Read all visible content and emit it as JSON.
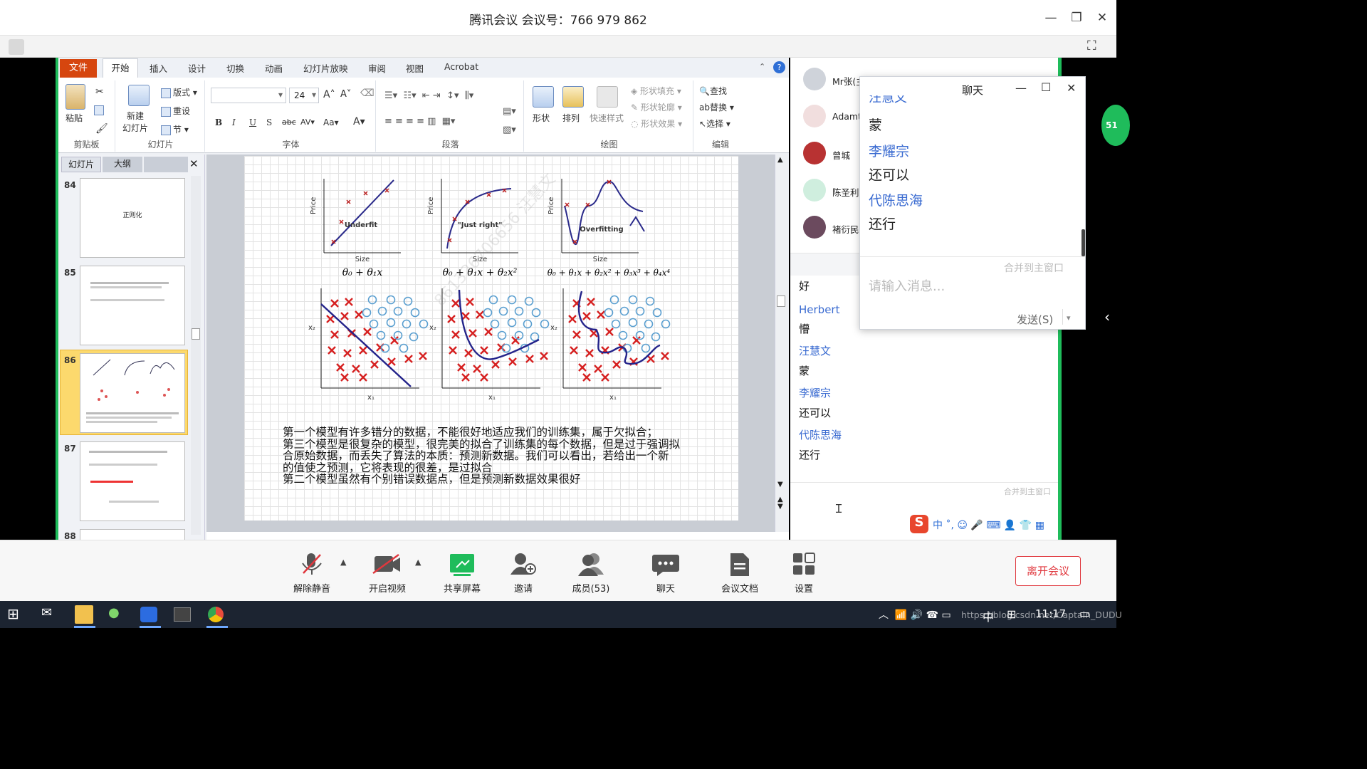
{
  "window": {
    "title": "腾讯会议 会议号：766 979 862"
  },
  "ribbon": {
    "tabs": [
      "文件",
      "开始",
      "插入",
      "设计",
      "切换",
      "动画",
      "幻灯片放映",
      "审阅",
      "视图",
      "Acrobat"
    ],
    "clipboard": {
      "paste": "粘贴",
      "name": "剪贴板"
    },
    "slides": {
      "new_slide": "新建\n幻灯片",
      "layout": "版式",
      "reset": "重设",
      "section": "节",
      "name": "幻灯片"
    },
    "font": {
      "size": "24",
      "name": "字体"
    },
    "paragraph": {
      "name": "段落"
    },
    "drawing": {
      "shape": "形状",
      "arrange": "排列",
      "quick_styles": "快速样式",
      "fill": "形状填充",
      "outline": "形状轮廓",
      "effect": "形状效果",
      "name": "绘图"
    },
    "editing": {
      "find": "查找",
      "replace": "替换",
      "select": "选择",
      "name": "编辑"
    }
  },
  "thumbs": {
    "tab_slides": "幻灯片",
    "tab_outline": "大纲",
    "items": [
      {
        "num": "84",
        "text": "正则化"
      },
      {
        "num": "85"
      },
      {
        "num": "86"
      },
      {
        "num": "87"
      },
      {
        "num": "88"
      }
    ]
  },
  "slide": {
    "plots": [
      {
        "ylabel": "Price",
        "xlabel": "Size",
        "label": "Underfit",
        "formula": "θ₀ + θ₁x"
      },
      {
        "ylabel": "Price",
        "xlabel": "Size",
        "label": "\"Just right\"",
        "formula": "θ₀ + θ₁x + θ₂x²"
      },
      {
        "ylabel": "Price",
        "xlabel": "Size",
        "label": "Overfitting",
        "formula": "θ₀ + θ₁x + θ₂x² + θ₃x³ + θ₄x⁴"
      }
    ],
    "class_plots": {
      "xlabel": "x₁",
      "ylabel": "x₂"
    },
    "text": [
      "第一个模型有许多错分的数据，不能很好地适应我们的训练集，属于欠拟合；",
      "第三个模型是很复杂的模型，很完美的拟合了训练集的每个数据，但是过于强调拟",
      "合原始数据，而丢失了算法的本质：预测新数据。我们可以看出，若给出一个新",
      "的值使之预测，它将表现的很差，是过拟合",
      "第二个模型虽然有个别错误数据点，但是预测新数据效果很好"
    ],
    "watermark": "861326706656 汪慧文"
  },
  "members": [
    {
      "name": "Mr张(主"
    },
    {
      "name": "Adamt"
    },
    {
      "name": "曾城"
    },
    {
      "name": "陈圣利"
    },
    {
      "name": "褚衍民"
    }
  ],
  "chat_messages": [
    {
      "text": "好"
    },
    {
      "name": "Herbert",
      "text": "懵"
    },
    {
      "name": "汪慧文",
      "text": "蒙"
    },
    {
      "name": "李耀宗",
      "text": "还可以"
    },
    {
      "name": "代陈思海",
      "text": "还行"
    }
  ],
  "chat_main": {
    "merge": "合并到主窗口"
  },
  "chat_popup": {
    "title": "聊天",
    "cut_name": "汪慧文",
    "messages": [
      {
        "text": "蒙"
      },
      {
        "name": "李耀宗",
        "text": "还可以"
      },
      {
        "name": "代陈思海",
        "text": "还行"
      }
    ],
    "merge": "合并到主窗口",
    "input_placeholder": "请输入消息...",
    "send": "发送(S)"
  },
  "side_badge": "51",
  "bottombar": {
    "buttons": [
      "解除静音",
      "开启视频",
      "共享屏幕",
      "邀请",
      "成员(53)",
      "聊天",
      "会议文档",
      "设置"
    ],
    "leave": "离开会议"
  },
  "taskbar": {
    "ime": "中",
    "time": "11:17",
    "url": "https://blog.csdn.net/Captain_DUDU"
  },
  "colors": {
    "accent_green": "#1fbc5b",
    "link_blue": "#3a6bd1",
    "leave_red": "#e0383e",
    "file_tab": "#d6460f"
  }
}
